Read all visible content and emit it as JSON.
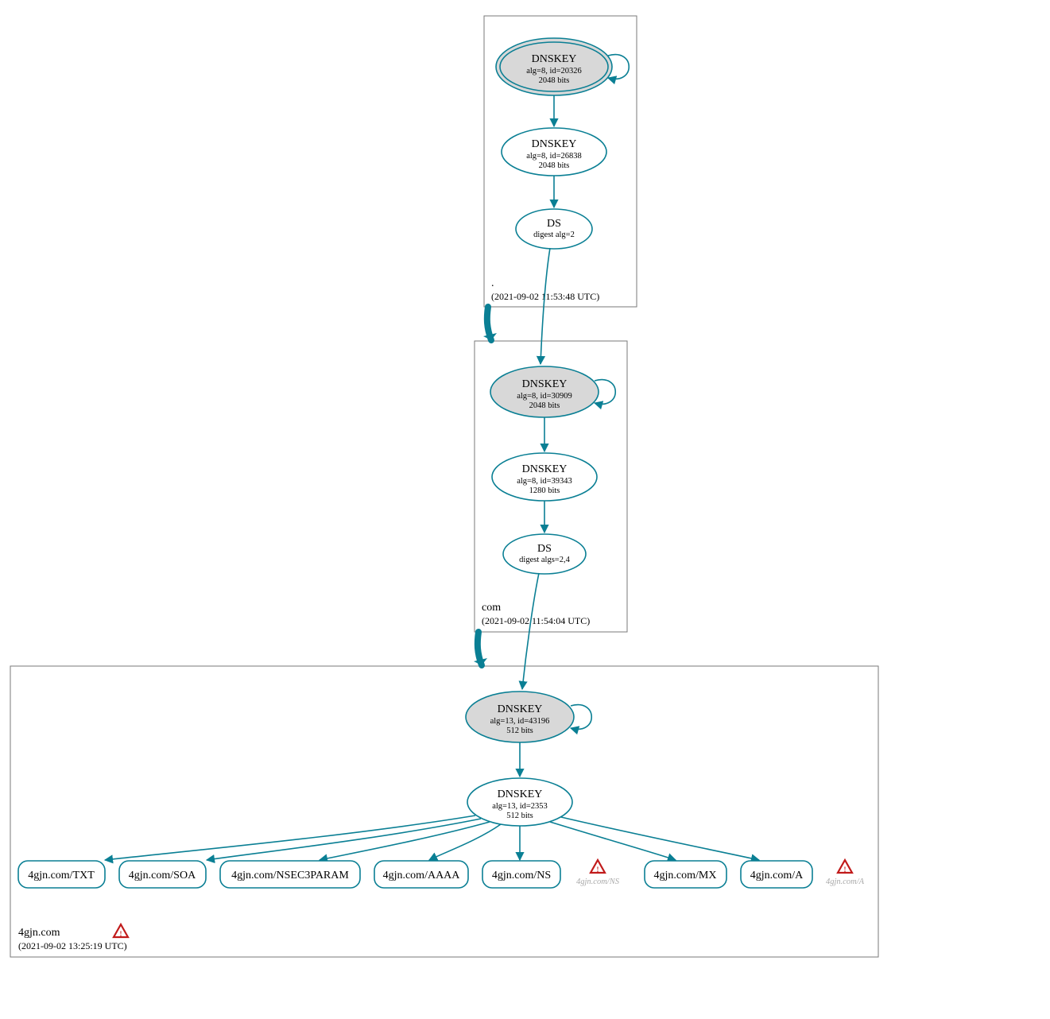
{
  "colors": {
    "stroke": "#0a7f94",
    "fillGray": "#d8d8d8",
    "fillWhite": "#ffffff",
    "zoneBox": "#7a7a7a",
    "black": "#000000",
    "warnRed": "#c11b1b"
  },
  "zones": {
    "root": {
      "label": ".",
      "timestamp": "(2021-09-02 11:53:48 UTC)",
      "dnskey1": {
        "title": "DNSKEY",
        "line1": "alg=8, id=20326",
        "line2": "2048 bits"
      },
      "dnskey2": {
        "title": "DNSKEY",
        "line1": "alg=8, id=26838",
        "line2": "2048 bits"
      },
      "ds": {
        "title": "DS",
        "line1": "digest alg=2"
      }
    },
    "com": {
      "label": "com",
      "timestamp": "(2021-09-02 11:54:04 UTC)",
      "dnskey1": {
        "title": "DNSKEY",
        "line1": "alg=8, id=30909",
        "line2": "2048 bits"
      },
      "dnskey2": {
        "title": "DNSKEY",
        "line1": "alg=8, id=39343",
        "line2": "1280 bits"
      },
      "ds": {
        "title": "DS",
        "line1": "digest algs=2,4"
      }
    },
    "domain": {
      "label": "4gjn.com",
      "timestamp": "(2021-09-02 13:25:19 UTC)",
      "dnskey1": {
        "title": "DNSKEY",
        "line1": "alg=13, id=43196",
        "line2": "512 bits"
      },
      "dnskey2": {
        "title": "DNSKEY",
        "line1": "alg=13, id=2353",
        "line2": "512 bits"
      }
    }
  },
  "leaves": {
    "txt": "4gjn.com/TXT",
    "soa": "4gjn.com/SOA",
    "nsec3": "4gjn.com/NSEC3PARAM",
    "aaaa": "4gjn.com/AAAA",
    "ns": "4gjn.com/NS",
    "mx": "4gjn.com/MX",
    "a": "4gjn.com/A"
  },
  "warnings": {
    "ns": "4gjn.com/NS",
    "a": "4gjn.com/A"
  }
}
